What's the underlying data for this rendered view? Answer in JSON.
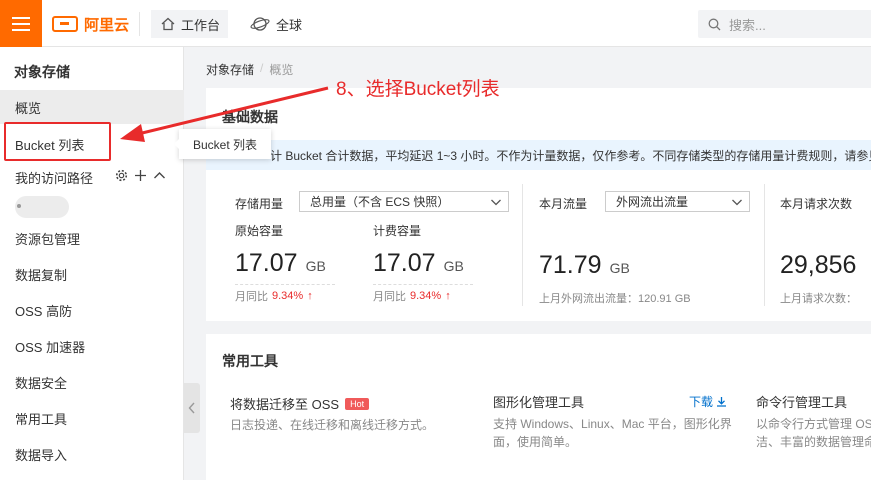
{
  "topbar": {
    "logo_text": "阿里云",
    "workbench_label": "工作台",
    "region_label": "全球",
    "search_placeholder": "搜索..."
  },
  "sidebar": {
    "title": "对象存储",
    "items": [
      {
        "label": "概览"
      },
      {
        "label": "Bucket 列表"
      },
      {
        "label": "我的访问路径"
      },
      {
        "label": "资源包管理"
      },
      {
        "label": "数据复制"
      },
      {
        "label": "OSS 高防"
      },
      {
        "label": "OSS 加速器"
      },
      {
        "label": "数据安全"
      },
      {
        "label": "常用工具"
      },
      {
        "label": "数据导入"
      }
    ],
    "path_marker": "c"
  },
  "tooltip": {
    "text": "Bucket 列表"
  },
  "breadcrumb": {
    "root": "对象存储",
    "current": "概览"
  },
  "annotation": {
    "text": "8、选择Bucket列表"
  },
  "basic": {
    "title": "基础数据",
    "notice": "计 Bucket 合计数据，平均延迟 1~3 小时。不作为计量数据，仅作参考。不同存储类型的存储用量计费规则，请参见",
    "storage": {
      "label": "存储用量",
      "select": "总用量（不含 ECS 快照）",
      "raw_label": "原始容量",
      "raw_value": "17.07",
      "raw_unit": "GB",
      "raw_mom_label": "月同比",
      "raw_mom": "9.34%",
      "bill_label": "计费容量",
      "bill_value": "17.07",
      "bill_unit": "GB",
      "bill_mom_label": "月同比",
      "bill_mom": "9.34%"
    },
    "traffic": {
      "label": "本月流量",
      "select": "外网流出流量",
      "value": "71.79",
      "unit": "GB",
      "foot": "上月外网流出流量：120.91 GB"
    },
    "requests": {
      "label": "本月请求次数",
      "value": "29,856",
      "foot": "上月请求次数："
    }
  },
  "tools": {
    "title": "常用工具",
    "items": [
      {
        "name": "将数据迁移至 OSS",
        "badge": "Hot",
        "desc": "日志投递、在线迁移和离线迁移方式。"
      },
      {
        "name": "图形化管理工具",
        "action": "下载",
        "desc_line1": "支持 Windows、Linux、Mac 平台，图形化界",
        "desc_line2": "面，使用简单。"
      },
      {
        "name": "命令行管理工具",
        "desc_line1": "以命令行方式管理 OS",
        "desc_line2": "洁、丰富的数据管理命"
      }
    ]
  },
  "colors": {
    "brand": "#ff6a00",
    "annotation": "#e82b2b",
    "link": "#0070cc"
  }
}
